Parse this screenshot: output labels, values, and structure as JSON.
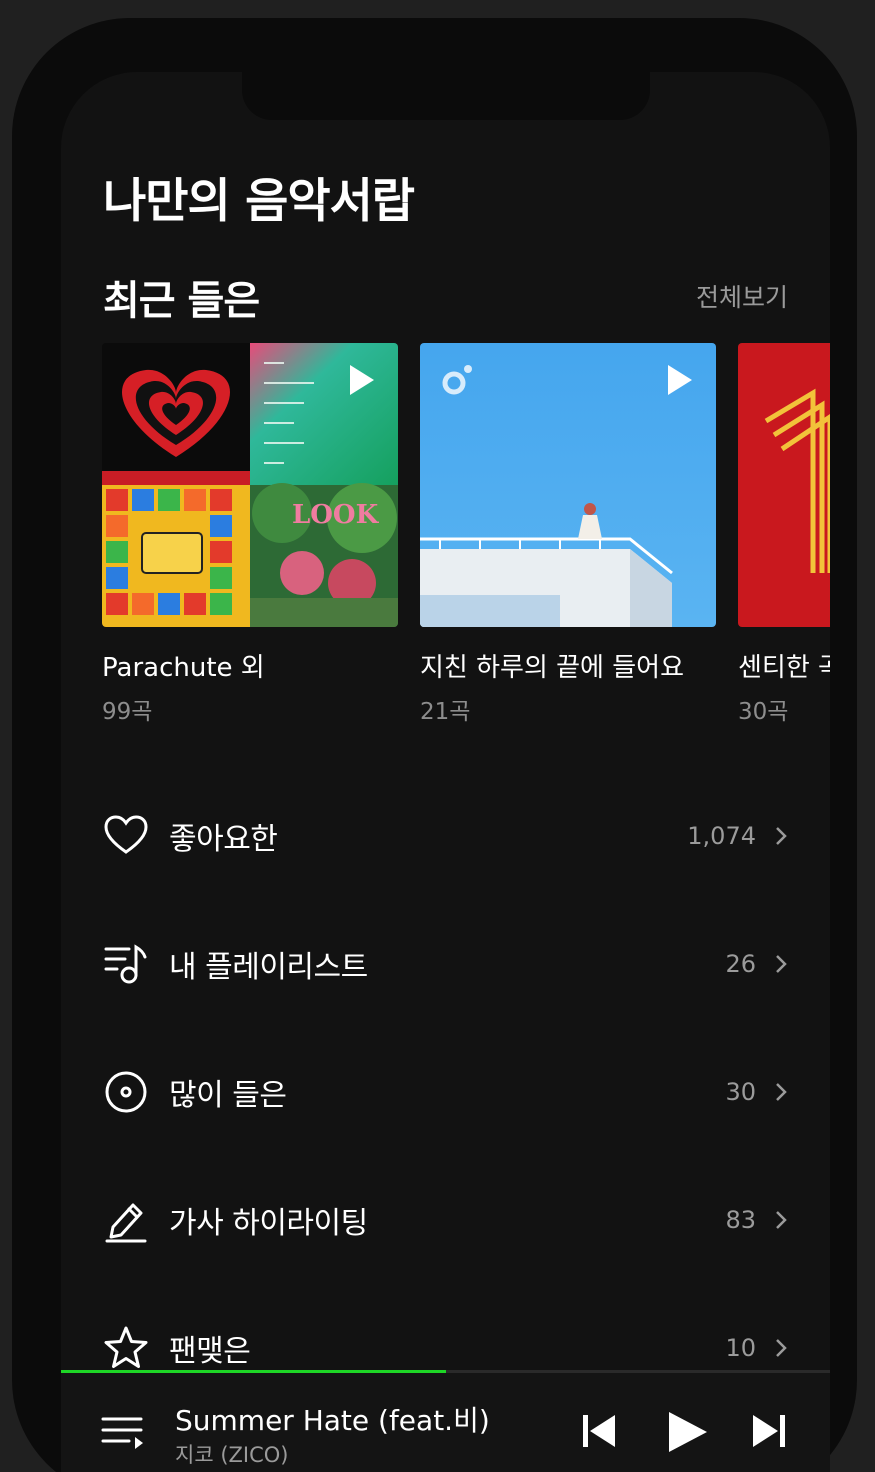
{
  "header": {
    "title": "나만의 음악서랍"
  },
  "recent": {
    "title": "최근 들은",
    "see_all": "전체보기",
    "cards": [
      {
        "title": "Parachute 외",
        "count": "99곡"
      },
      {
        "title": "지친 하루의 끝에 들어요",
        "count": "21곡"
      },
      {
        "title": "센티한 곡",
        "count": "30곡"
      }
    ]
  },
  "menu": [
    {
      "label": "좋아요한",
      "count": "1,074",
      "icon": "heart-icon"
    },
    {
      "label": "내 플레이리스트",
      "count": "26",
      "icon": "playlist-icon"
    },
    {
      "label": "많이 들은",
      "count": "30",
      "icon": "disc-icon"
    },
    {
      "label": "가사 하이라이팅",
      "count": "83",
      "icon": "highlight-pen-icon"
    },
    {
      "label": "팬맺은",
      "count": "10",
      "icon": "star-icon"
    }
  ],
  "player": {
    "song": "Summer Hate (feat.비)",
    "artist": "지코 (ZICO)",
    "progress": 0.5
  },
  "colors": {
    "accent": "#1ed626",
    "background": "#121212"
  }
}
